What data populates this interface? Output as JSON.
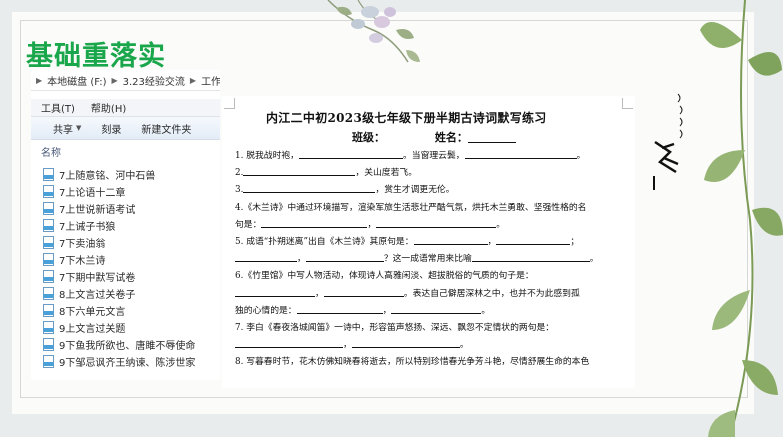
{
  "slide_title": "基础重落实",
  "explorer": {
    "breadcrumb": [
      "本地磁盘 (F:)",
      "3.23经验交流",
      "工作3"
    ],
    "menu": [
      "工具(T)",
      "帮助(H)"
    ],
    "toolbar": [
      "共享",
      "刻录",
      "新建文件夹"
    ],
    "column_header": "名称",
    "files": [
      "7上随意铭、河中石兽",
      "7上论语十二章",
      "7上世说新语考试",
      "7上诫子书狼",
      "7下卖油翁",
      "7下木兰诗",
      "7下期中默写试卷",
      "8上文言过关卷子",
      "8下六单元文言",
      "9上文言过关题",
      "9下鱼我所欲也、唐雎不辱使命",
      "9下邹忌讽齐王纳谏、陈涉世家"
    ]
  },
  "document": {
    "title": "内江二中初2023级七年级下册半期古诗词默写练习",
    "class_label": "班级：",
    "name_label": "姓名：",
    "questions": [
      {
        "prefix": "1. 脱我战时袍，",
        "blank1": "。当窗理云鬓，",
        "end": "。"
      },
      {
        "prefix": "2.",
        "mid": "，关山度若飞。"
      },
      {
        "prefix": "3.",
        "mid": "，赏生才调更无伦。"
      },
      {
        "line1": "4.《木兰诗》中通过环境描写，渲染军旅生活悲壮严酷气氛，烘托木兰勇敢、坚强性格的名",
        "line2": "句是：",
        "sep": "，",
        "end": "。"
      },
      {
        "line1": "5. 成语“扑朔迷离”出自《木兰诗》其原句是：",
        "sep": "，",
        "sep2": "；",
        "line2_sep": "，",
        "line2_mid": "？这一成语常用来比喻",
        "end": "。"
      },
      {
        "line1": "6.《竹里馆》中写人物活动，体现诗人高雅闲淡、超拔脱俗的气质的句子是：",
        "line2_end": "。表达自己僻居深林之中，也并不为此感到孤",
        "line3": "独的心情的是：",
        "sep": "，",
        "end": "。"
      },
      {
        "line1": "7. 李白《春夜洛城闻笛》一诗中，形容笛声悠扬、深远、飘忽不定情状的两句是：",
        "sep": "，",
        "end": "。"
      },
      {
        "line1": "8. 写暮春时节，花木仿佛知晓春将逝去，所以特别珍惜春光争芳斗艳，尽情舒展生命的本色"
      }
    ]
  },
  "colors": {
    "title_green": "#1aa64b",
    "slide_bg": "#fbfbf9",
    "leaf_green": "#7a9a55"
  }
}
